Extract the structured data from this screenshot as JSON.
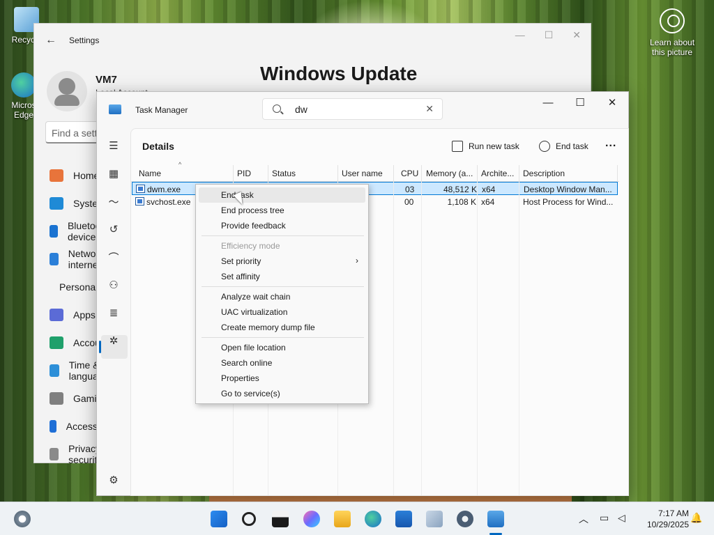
{
  "desktop": {
    "recycle_label": "Recycle",
    "edge_label_1": "Micros",
    "edge_label_2": "Edge",
    "learn_label_1": "Learn about",
    "learn_label_2": "this picture"
  },
  "settings": {
    "title": "Settings",
    "user_name": "VM7",
    "account_type": "Local Account",
    "page_title": "Windows Update",
    "search_placeholder": "Find a setting",
    "nav": [
      {
        "label": "Home",
        "icon": "home-icon",
        "color": "#e8743b"
      },
      {
        "label": "System",
        "icon": "system-icon",
        "color": "#1f8ad6"
      },
      {
        "label": "Bluetooth & devices",
        "icon": "bluetooth-icon",
        "color": "#1a73d1"
      },
      {
        "label": "Network & internet",
        "icon": "wifi-icon",
        "color": "#2b7fd8"
      },
      {
        "label": "Personalization",
        "icon": "brush-icon",
        "color": "#d9733a"
      },
      {
        "label": "Apps",
        "icon": "apps-icon",
        "color": "#5b6bd6"
      },
      {
        "label": "Accounts",
        "icon": "accounts-icon",
        "color": "#1fa06b"
      },
      {
        "label": "Time & language",
        "icon": "time-icon",
        "color": "#2d8fd8"
      },
      {
        "label": "Gaming",
        "icon": "gaming-icon",
        "color": "#7f7f7f"
      },
      {
        "label": "Accessibility",
        "icon": "accessibility-icon",
        "color": "#1f6fd6"
      },
      {
        "label": "Privacy & security",
        "icon": "shield-icon",
        "color": "#8a8a8a"
      }
    ]
  },
  "taskmgr": {
    "title": "Task Manager",
    "search_value": "dw",
    "section": "Details",
    "run_new_task": "Run new task",
    "end_task": "End task",
    "more": "...",
    "columns": [
      "Name",
      "PID",
      "Status",
      "User name",
      "CPU",
      "Memory (a...",
      "Archite...",
      "Description"
    ],
    "rows": [
      {
        "name": "dwm.exe",
        "pid": "",
        "status": "",
        "user": "",
        "cpu": "03",
        "memory": "48,512 K",
        "arch": "x64",
        "desc": "Desktop Window Man..."
      },
      {
        "name": "svchost.exe",
        "pid": "",
        "status": "",
        "user": "1",
        "cpu": "00",
        "memory": "1,108 K",
        "arch": "x64",
        "desc": "Host Process for Wind..."
      }
    ]
  },
  "context_menu": {
    "groups": [
      [
        "End task",
        "End process tree",
        "Provide feedback"
      ],
      [
        "Efficiency mode",
        "Set priority",
        "Set affinity"
      ],
      [
        "Analyze wait chain",
        "UAC virtualization",
        "Create memory dump file"
      ],
      [
        "Open file location",
        "Search online",
        "Properties",
        "Go to service(s)"
      ]
    ]
  },
  "taskbar": {
    "time": "7:17 AM",
    "date": "10/29/2025"
  }
}
